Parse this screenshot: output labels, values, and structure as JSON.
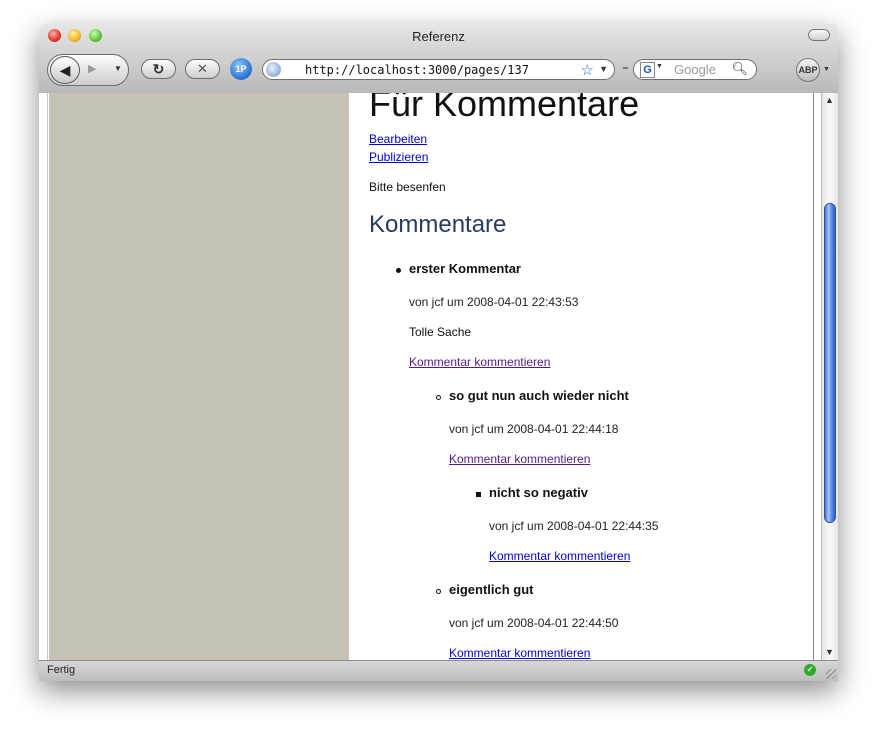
{
  "window": {
    "title": "Referenz"
  },
  "toolbar": {
    "url": "http://localhost:3000/pages/137",
    "search_placeholder": "Google",
    "onepassword_label": "1P",
    "abp_label": "ABP",
    "google_letter": "G"
  },
  "page": {
    "title": "Für Kommentare",
    "actions": [
      "Bearbeiten",
      "Publizieren"
    ],
    "body": "Bitte besenfen",
    "comments_heading": "Kommentare",
    "comments": [
      {
        "title": "erster Kommentar",
        "meta": "von jcf um 2008-04-01 22:43:53",
        "text": "Tolle Sache",
        "reply_label": "Kommentar kommentieren",
        "replies": [
          {
            "title": "so gut nun auch wieder nicht",
            "meta": "von jcf um 2008-04-01 22:44:18",
            "reply_label": "Kommentar kommentieren",
            "replies": [
              {
                "title": "nicht so negativ",
                "meta": "von jcf um 2008-04-01 22:44:35",
                "reply_label": "Kommentar kommentieren"
              }
            ]
          },
          {
            "title": "eigentlich gut",
            "meta": "von jcf um 2008-04-01 22:44:50",
            "reply_label": "Kommentar kommentieren"
          }
        ]
      }
    ]
  },
  "status": {
    "text": "Fertig"
  },
  "colors": {
    "sidebar": "#c5c1b4",
    "link": "#0000cc",
    "visited_link": "#551a8b",
    "heading": "#2a3a62",
    "scroll_thumb": "#3f6fd0"
  }
}
